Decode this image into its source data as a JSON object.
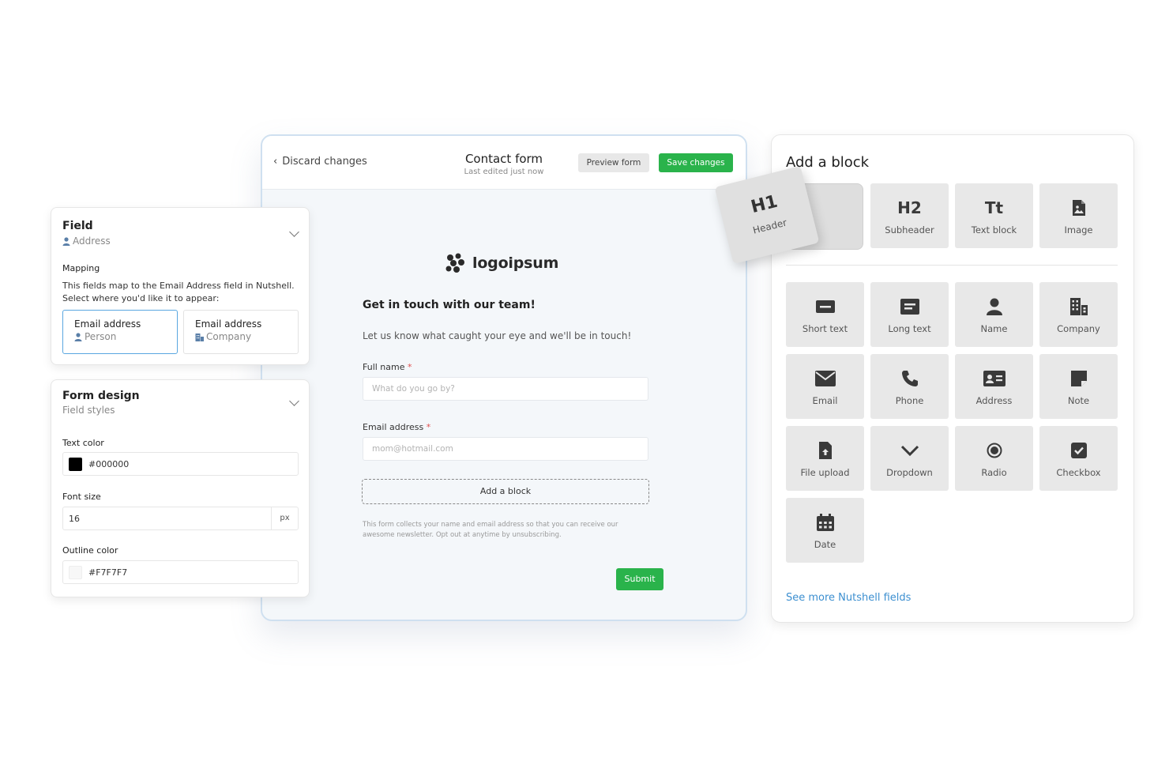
{
  "editor": {
    "discard_label": "Discard changes",
    "title": "Contact form",
    "subtitle": "Last edited just now",
    "preview_label": "Preview form",
    "save_label": "Save changes",
    "logo_text": "logoipsum",
    "heading": "Get in touch with our team!",
    "intro": "Let us know what caught your eye and we'll be in touch!",
    "fields": [
      {
        "label": "Full name",
        "required": "*",
        "placeholder": "What do you go by?"
      },
      {
        "label": "Email address",
        "required": "*",
        "placeholder": "mom@hotmail.com"
      }
    ],
    "add_block_label": "Add a block",
    "disclaimer": "This form collects your name and email address so that you can receive our awesome newsletter. Opt out at anytime by unsubscribing.",
    "submit_label": "Submit",
    "accent_color": "#2ab34b"
  },
  "field_panel": {
    "title": "Field",
    "subtitle": "Address",
    "mapping_label": "Mapping",
    "mapping_desc_1": "This fields map to the Email Address field in Nutshell.",
    "mapping_desc_2": "Select where you'd like it to appear:",
    "options": [
      {
        "title": "Email address",
        "sub": "Person",
        "icon": "person-icon",
        "selected": true
      },
      {
        "title": "Email address",
        "sub": "Company",
        "icon": "company-icon",
        "selected": false
      }
    ]
  },
  "design_panel": {
    "title": "Form design",
    "subtitle": "Field styles",
    "text_color_label": "Text color",
    "text_color_value": "#000000",
    "font_size_label": "Font size",
    "font_size_value": "16",
    "font_size_unit": "px",
    "outline_color_label": "Outline color",
    "outline_color_value": "#F7F7F7"
  },
  "blocks_panel": {
    "title": "Add a block",
    "dragging_block": {
      "glyph": "H1",
      "label": "Header"
    },
    "text_blocks": [
      {
        "glyph": "H2",
        "label": "Subheader"
      },
      {
        "glyph": "Tt",
        "label": "Text block"
      },
      {
        "icon": "image-icon",
        "label": "Image"
      }
    ],
    "field_blocks": [
      {
        "icon": "short-text-icon",
        "label": "Short text"
      },
      {
        "icon": "long-text-icon",
        "label": "Long text"
      },
      {
        "icon": "person-icon",
        "label": "Name"
      },
      {
        "icon": "company-icon",
        "label": "Company"
      },
      {
        "icon": "email-icon",
        "label": "Email"
      },
      {
        "icon": "phone-icon",
        "label": "Phone"
      },
      {
        "icon": "address-card-icon",
        "label": "Address"
      },
      {
        "icon": "note-icon",
        "label": "Note"
      },
      {
        "icon": "file-upload-icon",
        "label": "File upload"
      },
      {
        "icon": "chevron-down-icon",
        "label": "Dropdown"
      },
      {
        "icon": "radio-icon",
        "label": "Radio"
      },
      {
        "icon": "checkbox-icon",
        "label": "Checkbox"
      },
      {
        "icon": "calendar-icon",
        "label": "Date"
      }
    ],
    "see_more_label": "See more Nutshell fields",
    "link_color": "#3c8fd0"
  }
}
